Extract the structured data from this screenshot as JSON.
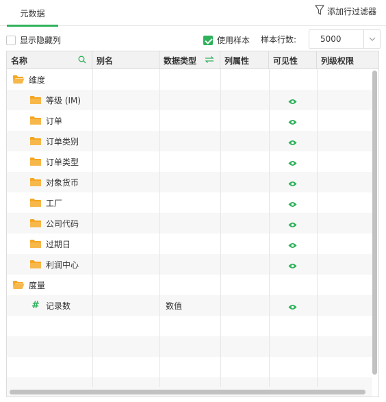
{
  "tabs": {
    "active_label": "元数据"
  },
  "toolbar": {
    "add_filter_label": "添加行过滤器"
  },
  "options": {
    "show_hidden_label": "显示隐藏列",
    "show_hidden_checked": false,
    "use_sample_label": "使用样本",
    "use_sample_checked": true,
    "sample_rows_label": "样本行数:",
    "sample_rows_value": "5000"
  },
  "columns": {
    "name": "名称",
    "alias": "别名",
    "data_type": "数据类型",
    "col_attr": "列属性",
    "visibility": "可见性",
    "col_permission": "列级权限"
  },
  "rows": [
    {
      "name": "维度",
      "kind": "folder-open",
      "level": 0,
      "data_type": "",
      "visible": false
    },
    {
      "name": "等级 (IM)",
      "kind": "folder",
      "level": 1,
      "data_type": "",
      "visible": true
    },
    {
      "name": "订单",
      "kind": "folder",
      "level": 1,
      "data_type": "",
      "visible": true
    },
    {
      "name": "订单类别",
      "kind": "folder",
      "level": 1,
      "data_type": "",
      "visible": true
    },
    {
      "name": "订单类型",
      "kind": "folder",
      "level": 1,
      "data_type": "",
      "visible": true
    },
    {
      "name": "对象货币",
      "kind": "folder",
      "level": 1,
      "data_type": "",
      "visible": true
    },
    {
      "name": "工厂",
      "kind": "folder",
      "level": 1,
      "data_type": "",
      "visible": true
    },
    {
      "name": "公司代码",
      "kind": "folder",
      "level": 1,
      "data_type": "",
      "visible": true
    },
    {
      "name": "过期日",
      "kind": "folder",
      "level": 1,
      "data_type": "",
      "visible": true
    },
    {
      "name": "利润中心",
      "kind": "folder",
      "level": 1,
      "data_type": "",
      "visible": true
    },
    {
      "name": "度量",
      "kind": "folder-open",
      "level": 0,
      "data_type": "",
      "visible": false
    },
    {
      "name": "记录数",
      "kind": "measure",
      "level": 1,
      "data_type": "数值",
      "visible": true
    }
  ],
  "colors": {
    "accent": "#2fb25b",
    "folder": "#f5a623"
  }
}
